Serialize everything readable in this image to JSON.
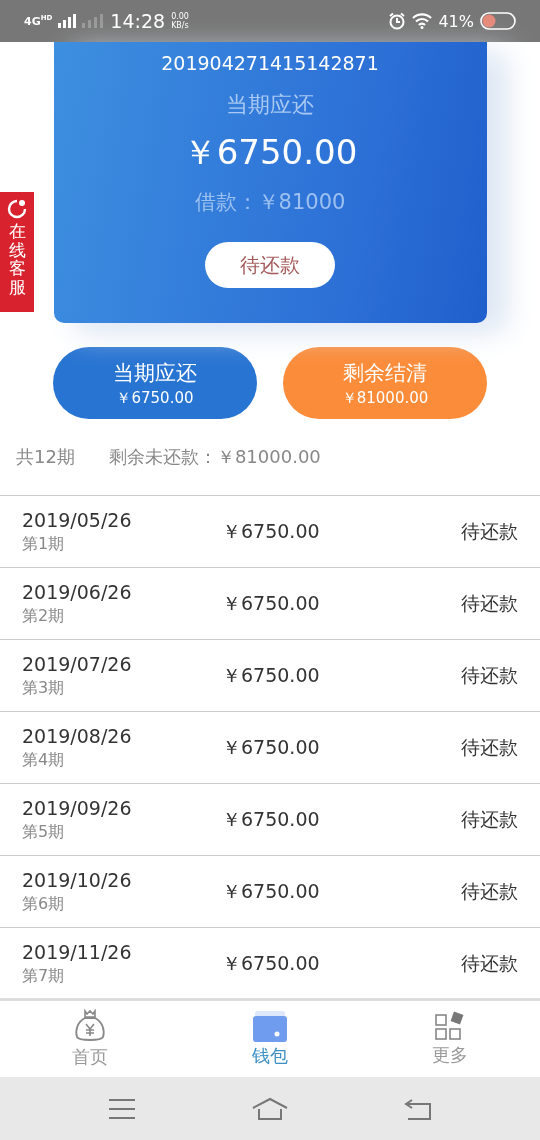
{
  "status_bar": {
    "network": "4G",
    "network_sub": "HD",
    "time": "14:28",
    "speed": "0.00",
    "speed_unit": "KB/s",
    "battery": "41%"
  },
  "card": {
    "order_no": "201904271415142871",
    "label": "当期应还",
    "amount": "￥6750.00",
    "loan": "借款：￥81000",
    "status_button": "待还款"
  },
  "side_tab": {
    "label": "在线客服"
  },
  "actions": [
    {
      "kind": "primary",
      "title": "当期应还",
      "amount": "￥6750.00"
    },
    {
      "kind": "secondary",
      "title": "剩余结清",
      "amount": "￥81000.00"
    }
  ],
  "summary": {
    "periods": "共12期",
    "remaining": "剩余未还款：￥81000.00"
  },
  "rows": [
    {
      "date": "2019/05/26",
      "period": "第1期",
      "amount": "￥6750.00",
      "status": "待还款"
    },
    {
      "date": "2019/06/26",
      "period": "第2期",
      "amount": "￥6750.00",
      "status": "待还款"
    },
    {
      "date": "2019/07/26",
      "period": "第3期",
      "amount": "￥6750.00",
      "status": "待还款"
    },
    {
      "date": "2019/08/26",
      "period": "第4期",
      "amount": "￥6750.00",
      "status": "待还款"
    },
    {
      "date": "2019/09/26",
      "period": "第5期",
      "amount": "￥6750.00",
      "status": "待还款"
    },
    {
      "date": "2019/10/26",
      "period": "第6期",
      "amount": "￥6750.00",
      "status": "待还款"
    },
    {
      "date": "2019/11/26",
      "period": "第7期",
      "amount": "￥6750.00",
      "status": "待还款"
    }
  ],
  "tab_bar": [
    {
      "kind": "home",
      "label": "首页",
      "selected": false
    },
    {
      "kind": "wallet",
      "label": "钱包",
      "selected": true
    },
    {
      "kind": "more",
      "label": "更多",
      "selected": false
    }
  ]
}
